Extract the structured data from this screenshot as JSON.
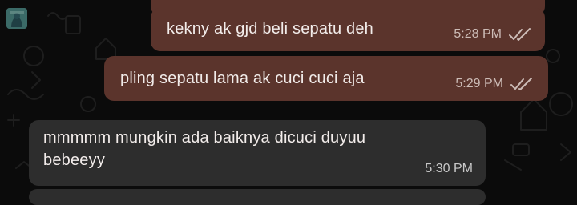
{
  "chat": {
    "messages": [
      {
        "direction": "out",
        "text": "kekny ak gjd beli sepatu deh",
        "time": "5:28 PM",
        "status": "read"
      },
      {
        "direction": "out",
        "text": "pling sepatu lama ak cuci cuci aja",
        "time": "5:29 PM",
        "status": "read"
      },
      {
        "direction": "in",
        "text_line1": "mmmmm mungkin ada baiknya dicuci duyuu",
        "text_line2": "bebeeyy",
        "time": "5:30 PM"
      }
    ]
  },
  "colors": {
    "background": "#0b0b0b",
    "outgoing_bubble": "#5b342c",
    "incoming_bubble": "#2d2d2d",
    "text": "#f2ecea",
    "meta": "#cdbcb7"
  },
  "icons": {
    "ticks": "double-check-icon",
    "avatar": "avatar"
  }
}
